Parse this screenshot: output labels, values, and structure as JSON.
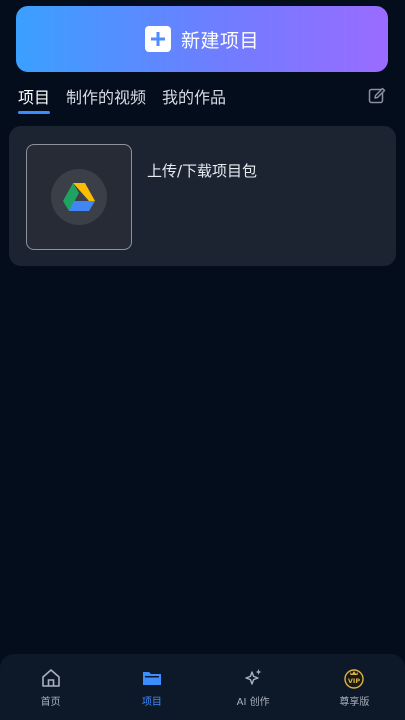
{
  "header": {
    "new_project_label": "新建项目"
  },
  "tabs": [
    {
      "label": "项目",
      "active": true
    },
    {
      "label": "制作的视频",
      "active": false
    },
    {
      "label": "我的作品",
      "active": false
    }
  ],
  "project_card": {
    "title": "上传/下载项目包",
    "icon": "google-drive-icon"
  },
  "bottom_nav": [
    {
      "label": "首页",
      "icon": "home-icon",
      "active": false
    },
    {
      "label": "项目",
      "icon": "folder-icon",
      "active": true
    },
    {
      "label": "AI 创作",
      "icon": "sparkle-icon",
      "active": false
    },
    {
      "label": "尊享版",
      "icon": "vip-crown-icon",
      "active": false
    }
  ],
  "colors": {
    "background": "#040d1c",
    "accent": "#3c8dff",
    "gradient_start": "#3aa0ff",
    "gradient_end": "#9a6bff"
  }
}
